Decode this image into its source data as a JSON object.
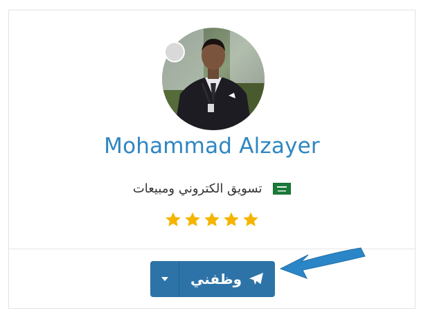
{
  "profile": {
    "name": "Mohammad Alzayer",
    "job_title": "تسويق الكتروني ومبيعات",
    "country_flag": "saudi-arabia-flag-icon",
    "rating_stars": 5,
    "status": "offline"
  },
  "actions": {
    "hire_label": "وظفني",
    "hire_icon": "paper-plane-icon",
    "dropdown_icon": "caret-down-icon"
  },
  "colors": {
    "name": "#2e86c1",
    "button": "#2d73a8",
    "star": "#f5b400",
    "annotation_arrow": "#2b86c8"
  }
}
